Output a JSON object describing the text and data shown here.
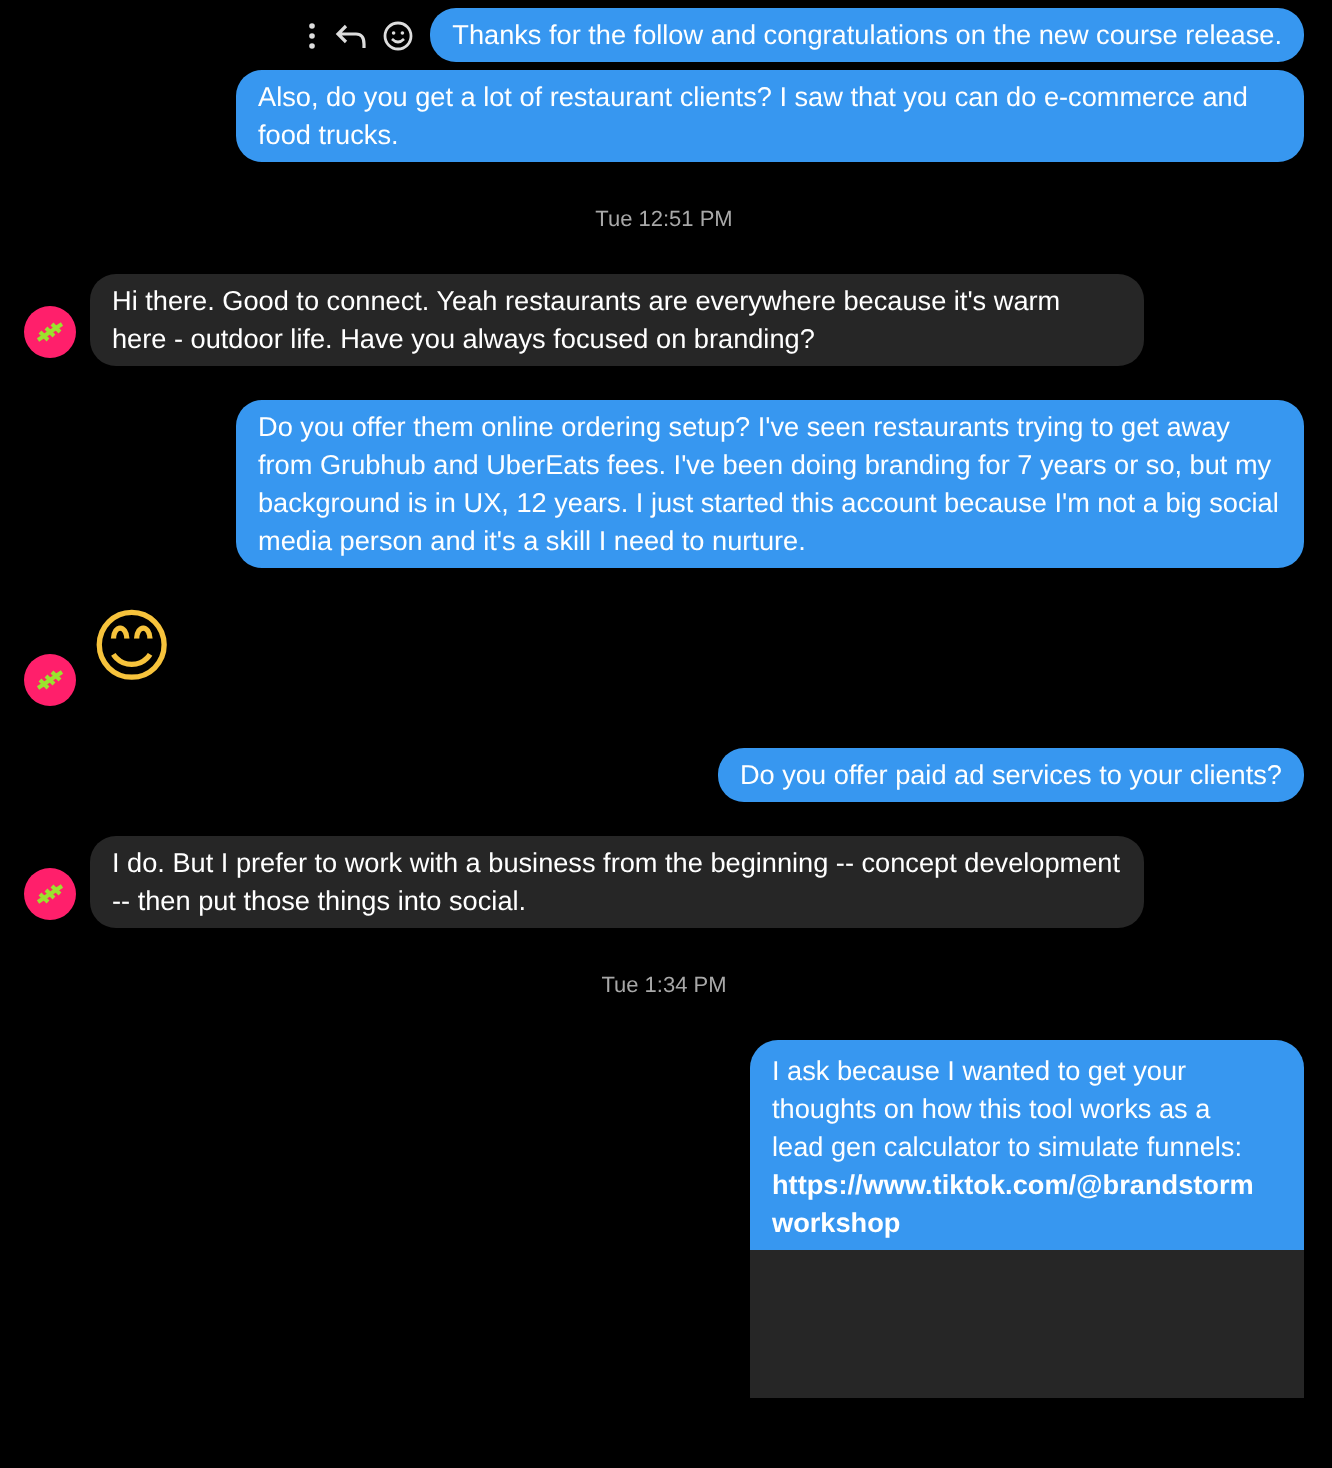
{
  "messages": [
    {
      "kind": "sent",
      "text": "Thanks for the follow and congratulations on the new course release.",
      "actions": true
    },
    {
      "kind": "sent",
      "text": "Also, do you get a lot of restaurant clients? I saw that you can do e-commerce and food trucks."
    },
    {
      "kind": "timestamp",
      "text": "Tue 12:51 PM"
    },
    {
      "kind": "received",
      "text": "Hi there. Good to connect. Yeah restaurants are everywhere because it's warm here - outdoor life. Have you always focused on branding?"
    },
    {
      "kind": "sent",
      "text": "Do you offer them online ordering setup? I've seen restaurants trying to get away from Grubhub and UberEats fees. I've been doing branding for 7 years or so, but my background is in UX, 12 years. I just started this account because I'm not a big social media person and it's a skill I need to nurture."
    },
    {
      "kind": "emoji",
      "text": "😊"
    },
    {
      "kind": "sent",
      "text": "Do you offer paid ad services to your clients?"
    },
    {
      "kind": "received",
      "text": "I do. But I prefer to work with a business from the beginning -- concept development -- then put those things into social."
    },
    {
      "kind": "timestamp",
      "text": "Tue 1:34 PM"
    },
    {
      "kind": "link",
      "text": "I ask because I wanted to get your thoughts on how this tool works as a lead gen calculator to simulate funnels:",
      "link": "https://www.tiktok.com/@brandstorm workshop"
    }
  ]
}
